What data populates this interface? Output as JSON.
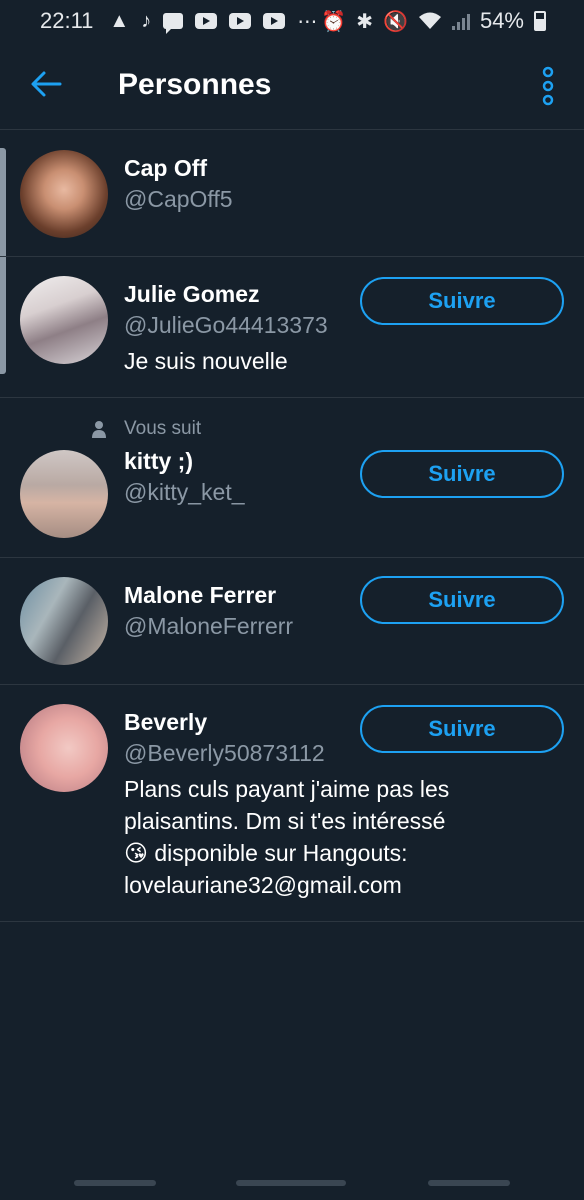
{
  "status_bar": {
    "time": "22:11",
    "battery": "54%",
    "left_icons": [
      "warning-icon",
      "music-note-icon",
      "chat-icon",
      "youtube-icon",
      "youtube-icon",
      "youtube-icon",
      "more-dots-icon"
    ],
    "right_icons": [
      "alarm-icon",
      "bluetooth-icon",
      "mute-icon",
      "wifi-icon",
      "signal-icon",
      "battery-icon"
    ]
  },
  "header": {
    "title": "Personnes",
    "back_icon": "back-arrow-icon",
    "menu_icon": "vertical-dots-icon"
  },
  "colors": {
    "background": "#15202b",
    "accent": "#1da1f2",
    "secondary_text": "#8b98a5",
    "divider": "#2c3640"
  },
  "people": [
    {
      "name": "Cap Off",
      "handle": "@CapOff5"
    },
    {
      "name": "Julie Gomez",
      "handle": "@JulieGo44413373",
      "bio": "Je suis nouvelle",
      "follow_label": "Suivre"
    },
    {
      "follows_you": "Vous suit",
      "name": "kitty ;)",
      "handle": "@kitty_ket_",
      "follow_label": "Suivre"
    },
    {
      "name": "Malone Ferrer",
      "handle": "@MaloneFerrerr",
      "follow_label": "Suivre"
    },
    {
      "name": "Beverly",
      "handle": "@Beverly50873112",
      "bio_line1": "Plans culs payant j'aime pas les",
      "bio_line2": "plaisantins. Dm si t'es intéressé",
      "bio_line3_emoji": "😘",
      "bio_line3": " disponible sur Hangouts:",
      "bio_line4": "lovelauriane32@gmail.com",
      "follow_label": "Suivre"
    }
  ]
}
